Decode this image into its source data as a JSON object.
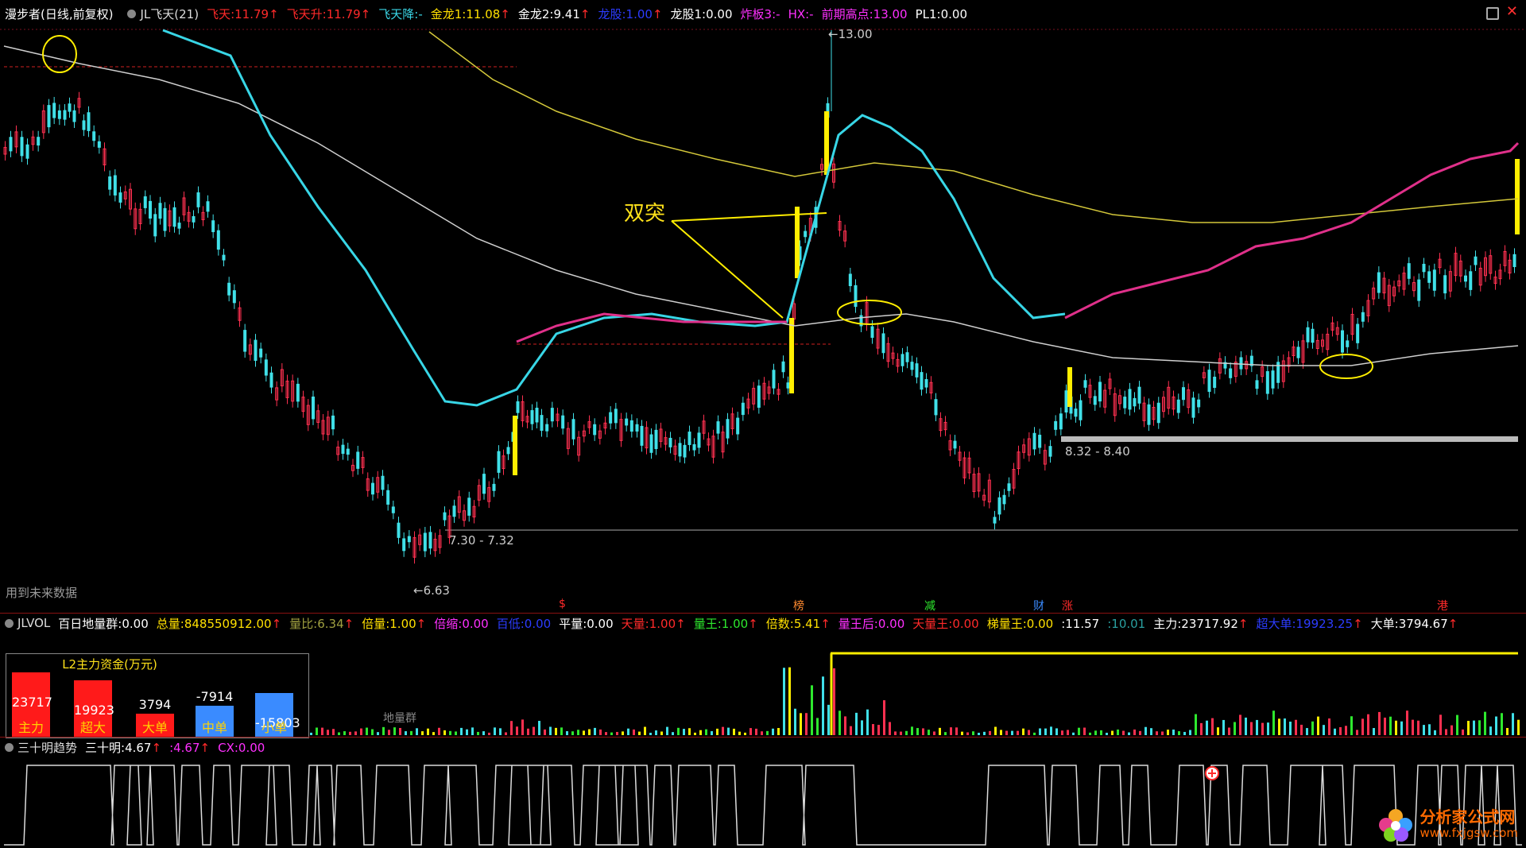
{
  "main_header": {
    "app": "漫步者(日线,前复权)",
    "indicator": "JL飞天(21)",
    "items": [
      {
        "label": "飞天:",
        "value": "11.79",
        "arrow": "↑",
        "color": "#ff2a2a"
      },
      {
        "label": "飞天升:",
        "value": "11.79",
        "arrow": "↑",
        "color": "#ff2a2a"
      },
      {
        "label": "飞天降:",
        "value": "-",
        "arrow": "",
        "color": "#3ad6e6"
      },
      {
        "label": "金龙1:",
        "value": "11.08",
        "arrow": "↑",
        "color": "#ffe000"
      },
      {
        "label": "金龙2:",
        "value": "9.41",
        "arrow": "↑",
        "color": "#ffffff"
      },
      {
        "label": "龙股:",
        "value": "1.00",
        "arrow": "↑",
        "color": "#2c3cff"
      },
      {
        "label": "龙股1:",
        "value": "0.00",
        "arrow": "",
        "color": "#ffffff"
      },
      {
        "label": "炸板3:",
        "value": "-",
        "arrow": "",
        "color": "#ff30ff"
      },
      {
        "label": "HX:",
        "value": "-",
        "arrow": "",
        "color": "#ff30ff"
      },
      {
        "label": "前期高点:",
        "value": "13.00",
        "arrow": "",
        "color": "#ff30ff"
      },
      {
        "label": "PL1:",
        "value": "0.00",
        "arrow": "",
        "color": "#ffffff"
      }
    ]
  },
  "price_chart": {
    "label_high": "←13.00",
    "label_low": "←6.63",
    "range_lower": "7.30 - 7.32",
    "range_upper": "8.32 - 8.40",
    "annotation": "双突",
    "future_data_note": "用到未来数据",
    "markers": [
      {
        "text": "$",
        "color": "#ff2a2a"
      },
      {
        "text": "榜",
        "color": "#ff8a30"
      },
      {
        "text": "减",
        "color": "#2ee82e"
      },
      {
        "text": "财",
        "color": "#3a8bff"
      },
      {
        "text": "涨",
        "color": "#ff2a2a"
      },
      {
        "text": "港",
        "color": "#ff2a2a"
      }
    ]
  },
  "volume_header": {
    "indicator": "JLVOL",
    "items": [
      {
        "label": "百日地量群:",
        "value": "0.00",
        "color": "#ffffff"
      },
      {
        "label": "总量:",
        "value": "848550912.00",
        "arrow": "↑",
        "color": "#ffe000"
      },
      {
        "label": "量比:",
        "value": "6.34",
        "arrow": "↑",
        "color": "#a0a040"
      },
      {
        "label": "倍量:",
        "value": "1.00",
        "arrow": "↑",
        "color": "#ffe000"
      },
      {
        "label": "倍缩:",
        "value": "0.00",
        "color": "#ff30ff"
      },
      {
        "label": "百低:",
        "value": "0.00",
        "color": "#2c3cff"
      },
      {
        "label": "平量:",
        "value": "0.00",
        "color": "#ffffff"
      },
      {
        "label": "天量:",
        "value": "1.00",
        "arrow": "↑",
        "color": "#ff2a2a"
      },
      {
        "label": "量王:",
        "value": "1.00",
        "arrow": "↑",
        "color": "#2ee82e"
      },
      {
        "label": "倍数:",
        "value": "5.41",
        "arrow": "↑",
        "color": "#ffe000"
      },
      {
        "label": "量王后:",
        "value": "0.00",
        "color": "#ff30ff"
      },
      {
        "label": "天量王:",
        "value": "0.00",
        "color": "#ff2a2a"
      },
      {
        "label": "梯量王:",
        "value": "0.00",
        "color": "#ffe000"
      },
      {
        "label": ":",
        "value": "11.57",
        "color": "#ffffff"
      },
      {
        "label": ":",
        "value": "10.01",
        "color": "#2aa0a0"
      },
      {
        "label": "主力:",
        "value": "23717.92",
        "arrow": "↑",
        "color": "#ffffff"
      },
      {
        "label": "超大单:",
        "value": "19923.25",
        "arrow": "↑",
        "color": "#2c3cff"
      },
      {
        "label": "大单:",
        "value": "3794.67",
        "arrow": "↑",
        "color": "#ffffff"
      }
    ],
    "volume_group_label": "地量群"
  },
  "l2_panel": {
    "title": "L2主力资金(万元)",
    "bars": [
      {
        "value": "23717",
        "name": "主力",
        "color": "#ff1a1a"
      },
      {
        "value": "19923",
        "name": "超大",
        "color": "#ff1a1a"
      },
      {
        "value": "3794",
        "name": "大单",
        "color": "#ff1a1a"
      },
      {
        "value": "-7914",
        "name": "中单",
        "color": "#3a8bff"
      },
      {
        "value": "-15803",
        "name": "小单",
        "color": "#3a8bff"
      }
    ]
  },
  "trend_header": {
    "indicator": "三十明趋势",
    "items": [
      {
        "label": "三十明:",
        "value": "4.67",
        "arrow": "↑",
        "color": "#ffffff"
      },
      {
        "label": ":",
        "value": "4.67",
        "arrow": "↑",
        "color": "#ff30ff"
      },
      {
        "label": "CX:",
        "value": "0.00",
        "color": "#ff30ff"
      }
    ]
  },
  "watermark": {
    "name": "分析家公式网",
    "url": "www.fxjgsw.com"
  }
}
